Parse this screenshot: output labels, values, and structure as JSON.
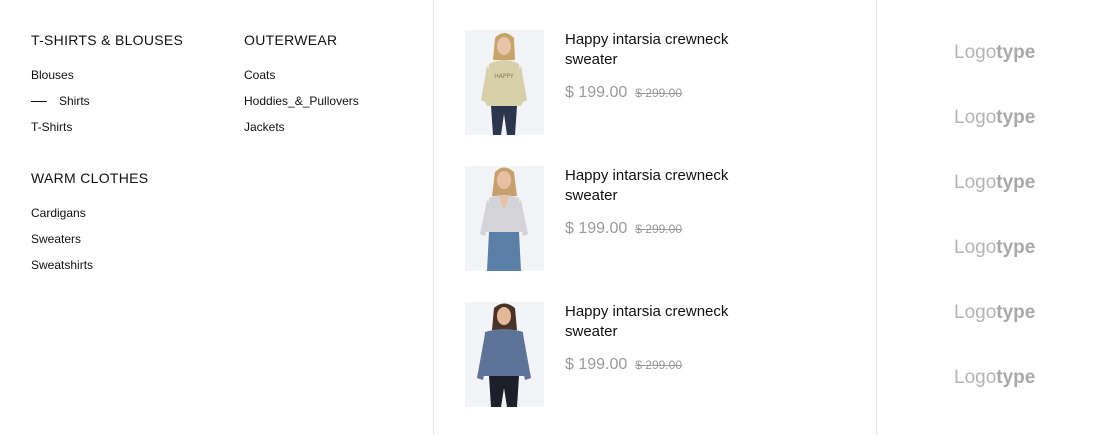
{
  "menu": {
    "columns": [
      {
        "groups": [
          {
            "title": "T-SHIRTS & BLOUSES",
            "items": [
              "Blouses",
              "Shirts",
              "T-Shirts"
            ]
          },
          {
            "title": "WARM CLOTHES",
            "items": [
              "Cardigans",
              "Sweaters",
              "Sweatshirts"
            ]
          }
        ]
      },
      {
        "groups": [
          {
            "title": "OUTERWEAR",
            "items": [
              "Coats",
              "Hoddies_&_Pullovers",
              "Jackets"
            ]
          }
        ]
      }
    ],
    "active_item": "Shirts"
  },
  "products": [
    {
      "name": "Happy intarsia crewneck sweater",
      "price": "$ 199.00",
      "old_price": "$ 299.00",
      "image": "woman-beige-sweater"
    },
    {
      "name": "Happy intarsia crewneck sweater",
      "price": "$ 199.00",
      "old_price": "$ 299.00",
      "image": "woman-grey-sweater"
    },
    {
      "name": "Happy intarsia crewneck sweater",
      "price": "$ 199.00",
      "old_price": "$ 299.00",
      "image": "woman-blue-sweater"
    }
  ],
  "logos": [
    {
      "light": "Logo",
      "bold": "type"
    },
    {
      "light": "Logo",
      "bold": "type"
    },
    {
      "light": "Logo",
      "bold": "type"
    },
    {
      "light": "Logo",
      "bold": "type"
    },
    {
      "light": "Logo",
      "bold": "type"
    },
    {
      "light": "Logo",
      "bold": "type"
    }
  ]
}
